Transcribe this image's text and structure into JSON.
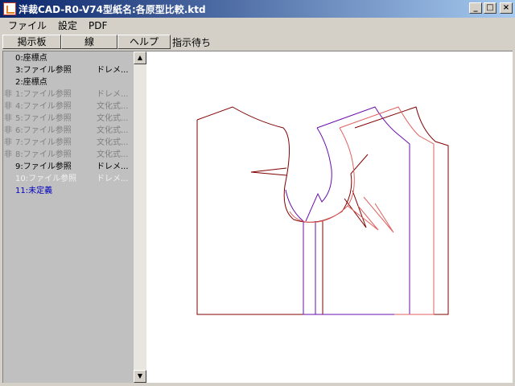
{
  "window": {
    "title": "洋裁CAD-R0-V74型紙名:各原型比較.ktd"
  },
  "menu": [
    "ファイル",
    "設定",
    "PDF"
  ],
  "toolbar": {
    "buttons": [
      "掲示板",
      "線",
      "ヘルプ"
    ],
    "status": "指示待ち"
  },
  "layers": [
    {
      "mark": "",
      "name": "0:座標点",
      "type": "",
      "state": "normal"
    },
    {
      "mark": "",
      "name": "3:ファイル参照",
      "type": "ドレメ...",
      "state": "normal"
    },
    {
      "mark": "",
      "name": "2:座標点",
      "type": "",
      "state": "normal"
    },
    {
      "mark": "非",
      "name": "1:ファイル参照",
      "type": "ドレメ...",
      "state": "disabled"
    },
    {
      "mark": "非",
      "name": "4:ファイル参照",
      "type": "文化式...",
      "state": "disabled"
    },
    {
      "mark": "非",
      "name": "5:ファイル参照",
      "type": "文化式...",
      "state": "disabled"
    },
    {
      "mark": "非",
      "name": "6:ファイル参照",
      "type": "文化式...",
      "state": "disabled"
    },
    {
      "mark": "非",
      "name": "7:ファイル参照",
      "type": "文化式...",
      "state": "disabled"
    },
    {
      "mark": "非",
      "name": "8:ファイル参照",
      "type": "文化式...",
      "state": "disabled"
    },
    {
      "mark": "",
      "name": "9:ファイル参照",
      "type": "ドレメ...",
      "state": "normal"
    },
    {
      "mark": "",
      "name": "10:ファイル参照",
      "type": "ドレメ...",
      "state": "light"
    },
    {
      "mark": "",
      "name": "11:未定義",
      "type": "",
      "state": "undef"
    }
  ],
  "colors": {
    "pattern_dark_red": "#800000",
    "pattern_purple": "#6a0dad",
    "pattern_red": "#e06060",
    "selected_layer": "#0000c0"
  },
  "icons": {
    "app": "app-icon",
    "minimize": "minimize-icon",
    "maximize": "maximize-icon",
    "close": "close-icon",
    "scroll_up": "arrow-up-icon",
    "scroll_down": "arrow-down-icon"
  }
}
